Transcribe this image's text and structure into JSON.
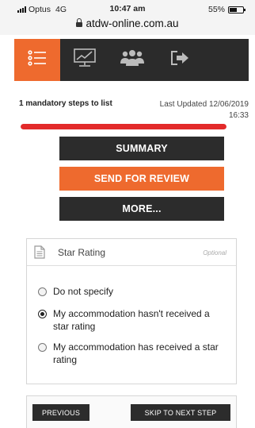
{
  "status_bar": {
    "carrier": "Optus",
    "network": "4G",
    "time": "10:47 am",
    "battery": "55%",
    "url": "atdw-online.com.au"
  },
  "nav": {
    "items": [
      {
        "icon": "menu-list-icon",
        "active": true
      },
      {
        "icon": "monitor-chart-icon",
        "active": false
      },
      {
        "icon": "users-icon",
        "active": false
      },
      {
        "icon": "logout-icon",
        "active": false
      }
    ],
    "active_color": "#ee6a2e",
    "bar_color": "#2b2b2b"
  },
  "progress": {
    "steps_text": "1 mandatory steps to list",
    "updated_label": "Last Updated 12/06/2019",
    "updated_time": "16:33",
    "fill_fraction": 1.0,
    "fill_color": "#e32a2a"
  },
  "actions": {
    "summary": "SUMMARY",
    "send_for_review": "SEND FOR REVIEW",
    "more": "MORE..."
  },
  "card": {
    "icon": "document-icon",
    "title": "Star Rating",
    "optional": "Optional",
    "options": [
      {
        "label": "Do not specify",
        "checked": false
      },
      {
        "label": "My accommodation hasn't received a star rating",
        "checked": true
      },
      {
        "label": "My accommodation has received a star rating",
        "checked": false
      }
    ]
  },
  "footer": {
    "previous": "PREVIOUS",
    "skip": "SKIP TO NEXT STEP"
  }
}
